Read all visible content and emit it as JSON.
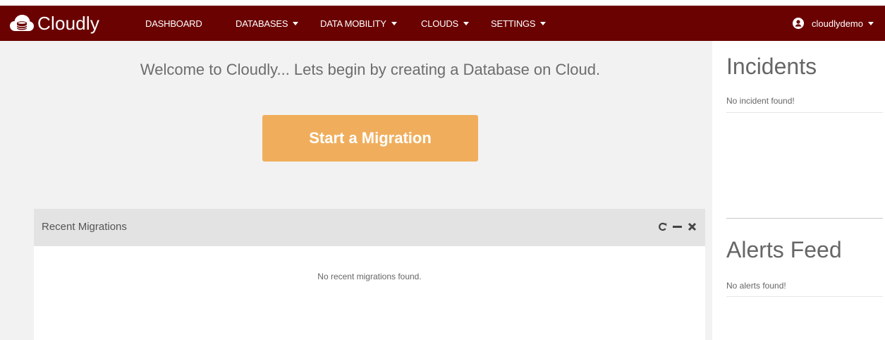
{
  "navbar": {
    "brand": {
      "name": "Cloudly",
      "icon": "cloud-database-icon"
    },
    "items": [
      {
        "label": "DASHBOARD",
        "dropdown": false
      },
      {
        "label": "DATABASES",
        "dropdown": true
      },
      {
        "label": "DATA MOBILITY",
        "dropdown": true
      },
      {
        "label": "CLOUDS",
        "dropdown": true
      },
      {
        "label": "SETTINGS",
        "dropdown": true
      }
    ],
    "user": {
      "name": "cloudlydemo",
      "icon": "user-circle-icon"
    }
  },
  "main": {
    "welcome_text": "Welcome to Cloudly... Lets begin by creating a Database on Cloud.",
    "start_button_label": "Start a Migration",
    "recent_migrations": {
      "title": "Recent Migrations",
      "tools": [
        "refresh-icon",
        "minimize-icon",
        "close-icon"
      ],
      "empty_text": "No recent migrations found."
    }
  },
  "sidebar": {
    "incidents": {
      "title": "Incidents",
      "empty_text": "No incident found!"
    },
    "alerts": {
      "title": "Alerts Feed",
      "empty_text": "No alerts found!"
    }
  },
  "colors": {
    "navbar_bg": "#6b0202",
    "accent_button": "#f0ae5c",
    "main_bg": "#f2f2f2",
    "panel_header_bg": "#e3e3e3"
  }
}
